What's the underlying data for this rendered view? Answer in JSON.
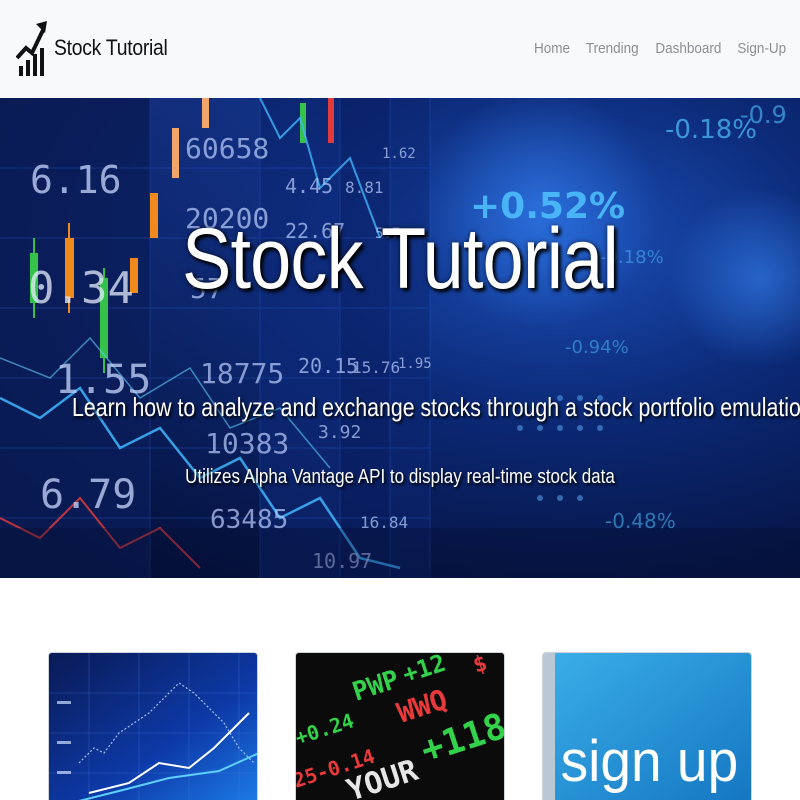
{
  "navbar": {
    "brand_name": "Stock Tutorial",
    "brand_icon": "rising-bar-chart-arrow-icon",
    "links": [
      "Home",
      "Trending",
      "Dashboard",
      "Sign-Up"
    ]
  },
  "hero": {
    "title": "Stock Tutorial",
    "subtitle": "Learn how to analyze and exchange stocks through a stock portfolio emulation!",
    "tagline": "Utilizes Alpha Vantage API to display real-time stock data",
    "background_numbers": [
      "6.16",
      "0.34",
      "1.55",
      "6.79",
      "60658",
      "20200",
      "57",
      "18775",
      "10383",
      "63485",
      "4.45",
      "22.67",
      "20.15",
      "15.76",
      "1.95",
      "3.92",
      "10.97",
      "16.84",
      "8.81",
      "5.7",
      "1.62",
      "+0.52%",
      "-0.18%",
      "-0.18%",
      "-0.94%",
      "-0.48%",
      "-0.9"
    ]
  },
  "cards": {
    "card1_image": "blue-stock-chart-image",
    "card2_image": "stock-ticker-board-image",
    "card2_text": [
      "+0.24",
      "PWP",
      "+12",
      "WWQ",
      "25-0.14",
      "YOUR",
      "+118"
    ],
    "card3_image": "sign-up-image",
    "card3_text": "sign up"
  },
  "colors": {
    "navbar_bg": "#f8f9fa",
    "nav_link": "#8a8f94",
    "hero_dark": "#061649",
    "hero_accent": "#1b4fb8"
  }
}
